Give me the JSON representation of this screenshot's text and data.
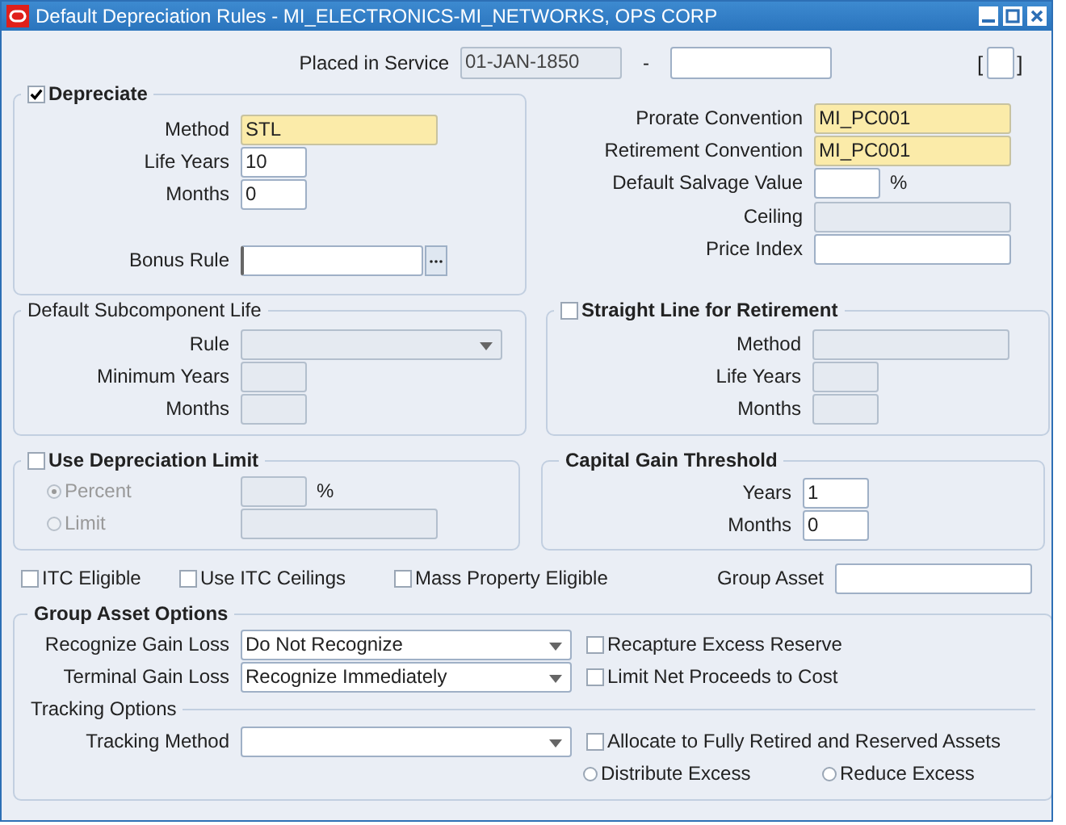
{
  "window": {
    "title": "Default Depreciation Rules - MI_ELECTRONICS-MI_NETWORKS, OPS CORP"
  },
  "placed_in_service": {
    "label": "Placed in Service",
    "from": {
      "value": "01-JAN-1850",
      "required": false,
      "disabled": true
    },
    "separator": "-",
    "to": {
      "required": false,
      "disabled": false
    }
  },
  "bracket": {
    "open": "[",
    "close": "]"
  },
  "depreciate": {
    "label": "Depreciate",
    "checked": true,
    "fields": [
      {
        "label": "Method",
        "value": "STL",
        "required": true,
        "disabled": false,
        "kind": "long"
      },
      {
        "label": "Life Years",
        "value": "10",
        "required": false,
        "disabled": false,
        "kind": "short"
      },
      {
        "label": "Months",
        "value": "0",
        "required": false,
        "disabled": false,
        "kind": "short"
      },
      {
        "label": "Bonus Rule",
        "required": false,
        "disabled": false,
        "kind": "lov"
      }
    ]
  },
  "conventions": [
    {
      "label": "Prorate Convention",
      "value": "MI_PC001",
      "required": true,
      "disabled": false,
      "kind": "long"
    },
    {
      "label": "Retirement Convention",
      "value": "MI_PC001",
      "required": true,
      "disabled": false,
      "kind": "long"
    },
    {
      "label": "Default Salvage Value",
      "required": false,
      "disabled": false,
      "kind": "short",
      "suffix": "%"
    },
    {
      "label": "Ceiling",
      "required": false,
      "disabled": true,
      "kind": "long"
    },
    {
      "label": "Price Index",
      "required": false,
      "disabled": false,
      "kind": "long"
    }
  ],
  "subcomponent_life": {
    "label": "Default Subcomponent Life",
    "fields": [
      {
        "label": "Rule",
        "required": false,
        "disabled": true,
        "kind": "select"
      },
      {
        "label": "Minimum Years",
        "required": false,
        "disabled": true,
        "kind": "short"
      },
      {
        "label": "Months",
        "required": false,
        "disabled": true,
        "kind": "short"
      }
    ]
  },
  "straight_line": {
    "label": "Straight Line for Retirement",
    "checked": false,
    "fields": [
      {
        "label": "Method",
        "required": false,
        "disabled": true,
        "kind": "long"
      },
      {
        "label": "Life Years",
        "required": false,
        "disabled": true,
        "kind": "short"
      },
      {
        "label": "Months",
        "required": false,
        "disabled": true,
        "kind": "short"
      }
    ]
  },
  "depreciation_limit": {
    "label": "Use Depreciation Limit",
    "checked": false,
    "options": [
      {
        "label": "Percent",
        "selected": true,
        "disabled": true,
        "field": {
          "required": false,
          "disabled": true,
          "kind": "short",
          "suffix": "%"
        }
      },
      {
        "label": "Limit",
        "selected": false,
        "disabled": true,
        "field": {
          "required": false,
          "disabled": true,
          "kind": "long"
        }
      }
    ]
  },
  "capital_gain_threshold": {
    "label": "Capital Gain Threshold",
    "fields": [
      {
        "label": "Years",
        "value": "1",
        "required": false,
        "disabled": false,
        "kind": "short"
      },
      {
        "label": "Months",
        "value": "0",
        "required": false,
        "disabled": false,
        "kind": "short"
      }
    ]
  },
  "flags": [
    {
      "label": "ITC Eligible",
      "checked": false
    },
    {
      "label": "Use ITC Ceilings",
      "checked": false
    },
    {
      "label": "Mass Property Eligible",
      "checked": false
    }
  ],
  "group_asset": {
    "label": "Group Asset",
    "required": false,
    "disabled": false,
    "kind": "long"
  },
  "group_asset_options": {
    "label": "Group Asset Options",
    "rows": [
      {
        "label": "Recognize Gain Loss",
        "field": {
          "value": "Do Not Recognize",
          "required": false,
          "disabled": false,
          "kind": "select"
        },
        "checkbox": {
          "label": "Recapture Excess Reserve",
          "checked": false
        }
      },
      {
        "label": "Terminal Gain Loss",
        "field": {
          "value": "Recognize Immediately",
          "required": false,
          "disabled": false,
          "kind": "select"
        },
        "checkbox": {
          "label": "Limit Net Proceeds to Cost",
          "checked": false
        }
      }
    ],
    "tracking": {
      "label": "Tracking Options",
      "method": {
        "label": "Tracking Method",
        "required": false,
        "disabled": false,
        "kind": "select"
      },
      "checkbox": {
        "label": "Allocate to Fully Retired and Reserved Assets",
        "checked": false
      },
      "radios": [
        {
          "label": "Distribute Excess",
          "selected": false
        },
        {
          "label": "Reduce Excess",
          "selected": false
        }
      ]
    }
  }
}
